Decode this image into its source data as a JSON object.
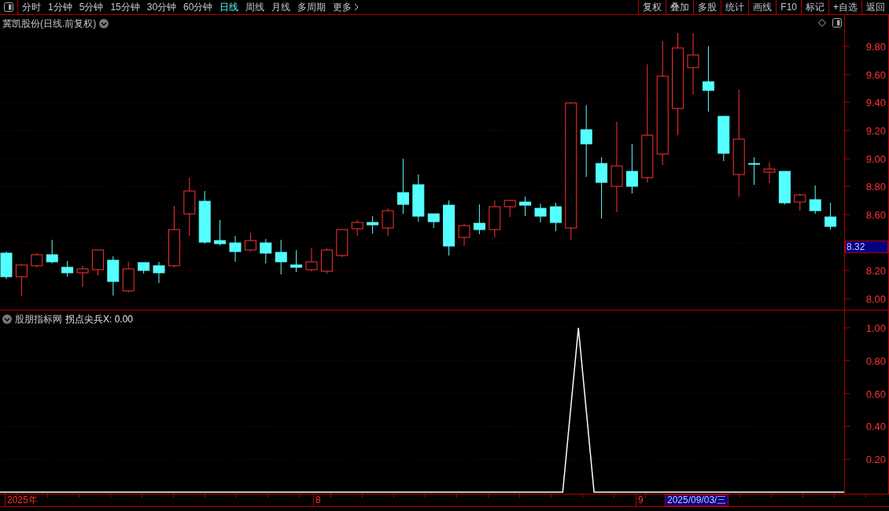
{
  "toolbar": {
    "periods": [
      {
        "label": "分时",
        "selected": false
      },
      {
        "label": "1分钟",
        "selected": false
      },
      {
        "label": "5分钟",
        "selected": false
      },
      {
        "label": "15分钟",
        "selected": false
      },
      {
        "label": "30分钟",
        "selected": false
      },
      {
        "label": "60分钟",
        "selected": false
      },
      {
        "label": "日线",
        "selected": true
      },
      {
        "label": "周线",
        "selected": false
      },
      {
        "label": "月线",
        "selected": false
      },
      {
        "label": "多周期",
        "selected": false
      },
      {
        "label": "更多",
        "selected": false
      }
    ],
    "actions": [
      "复权",
      "叠加",
      "多股",
      "统计",
      "画线",
      "F10",
      "标记",
      "+自选",
      "返回"
    ]
  },
  "main_panel": {
    "title": "冀凯股份(日线.前复权)",
    "price_axis": [
      "9.80",
      "9.60",
      "9.40",
      "9.20",
      "9.00",
      "8.80",
      "8.60",
      "8.20",
      "8.00"
    ],
    "price_marker": "8.32"
  },
  "indicator_panel": {
    "source": "股朋指标网",
    "label": "拐点尖兵X: 0.00",
    "chart_data": {
      "type": "line",
      "grid": true,
      "ylim": [
        0,
        1
      ],
      "yticks": [
        {
          "value": 0.2,
          "label": "0.20"
        },
        {
          "value": 0.4,
          "label": "0.40"
        },
        {
          "value": 0.6,
          "label": "0.60"
        },
        {
          "value": 0.8,
          "label": "0.80"
        },
        {
          "value": 1,
          "label": "1.00"
        }
      ],
      "series": [
        {
          "color": "#ffffff",
          "values": [
            0,
            0,
            0,
            0,
            0,
            0,
            0,
            0,
            0,
            0,
            0,
            0,
            0,
            0,
            0,
            0,
            0,
            0,
            0,
            0,
            0,
            0,
            0,
            0,
            0,
            0,
            0,
            0,
            0,
            0,
            0,
            0,
            0,
            0,
            0,
            0,
            0,
            1,
            0,
            0,
            0,
            0,
            0,
            0,
            0,
            0,
            0,
            0,
            0,
            0,
            0,
            0,
            0,
            0,
            0
          ]
        }
      ]
    }
  },
  "date_axis": {
    "labels": [
      "2025年",
      "8",
      "9"
    ],
    "cursor_date": "2025/09/03/三"
  }
}
